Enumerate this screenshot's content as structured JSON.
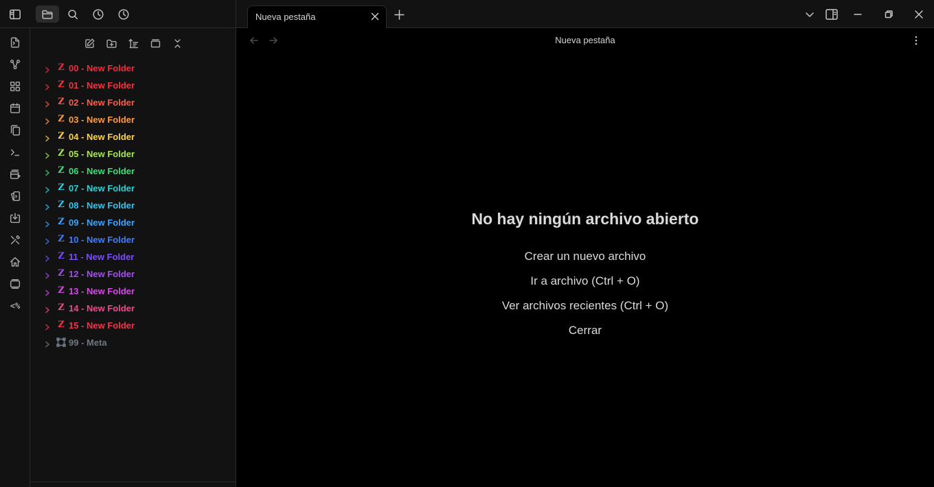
{
  "tab": {
    "title": "Nueva pestaña",
    "close_icon": "close-icon"
  },
  "view_header": {
    "title": "Nueva pestaña"
  },
  "empty_state": {
    "title": "No hay ningún archivo abierto",
    "actions": [
      "Crear un nuevo archivo",
      "Ir a archivo (Ctrl + O)",
      "Ver archivos recientes (Ctrl + O)",
      "Cerrar"
    ]
  },
  "ribbon": {
    "templater_label": "<%"
  },
  "folders": [
    {
      "name": "00 - New Folder",
      "color": "#ef2b3d",
      "icon": "Z"
    },
    {
      "name": "01 - New Folder",
      "color": "#f5333f",
      "icon": "Z"
    },
    {
      "name": "02 - New Folder",
      "color": "#ff5a48",
      "icon": "Z"
    },
    {
      "name": "03 - New Folder",
      "color": "#ff9a3c",
      "icon": "Z"
    },
    {
      "name": "04 - New Folder",
      "color": "#ffd43a",
      "icon": "Z"
    },
    {
      "name": "05 - New Folder",
      "color": "#a8e64a",
      "icon": "Z"
    },
    {
      "name": "06 - New Folder",
      "color": "#35e07a",
      "icon": "Z"
    },
    {
      "name": "07 - New Folder",
      "color": "#27d3d6",
      "icon": "Z"
    },
    {
      "name": "08 - New Folder",
      "color": "#2fc3ef",
      "icon": "Z"
    },
    {
      "name": "09 - New Folder",
      "color": "#3aa4ff",
      "icon": "Z"
    },
    {
      "name": "10 - New Folder",
      "color": "#3f7dff",
      "icon": "Z"
    },
    {
      "name": "11 - New Folder",
      "color": "#7a4dff",
      "icon": "Z"
    },
    {
      "name": "12 - New Folder",
      "color": "#a54cf4",
      "icon": "Z"
    },
    {
      "name": "13 - New Folder",
      "color": "#d648e8",
      "icon": "Z"
    },
    {
      "name": "14 - New Folder",
      "color": "#f3468f",
      "icon": "Z"
    },
    {
      "name": "15 - New Folder",
      "color": "#f2344a",
      "icon": "Z"
    },
    {
      "name": "99 - Meta",
      "color": "#6f7785",
      "icon": "frame"
    }
  ]
}
